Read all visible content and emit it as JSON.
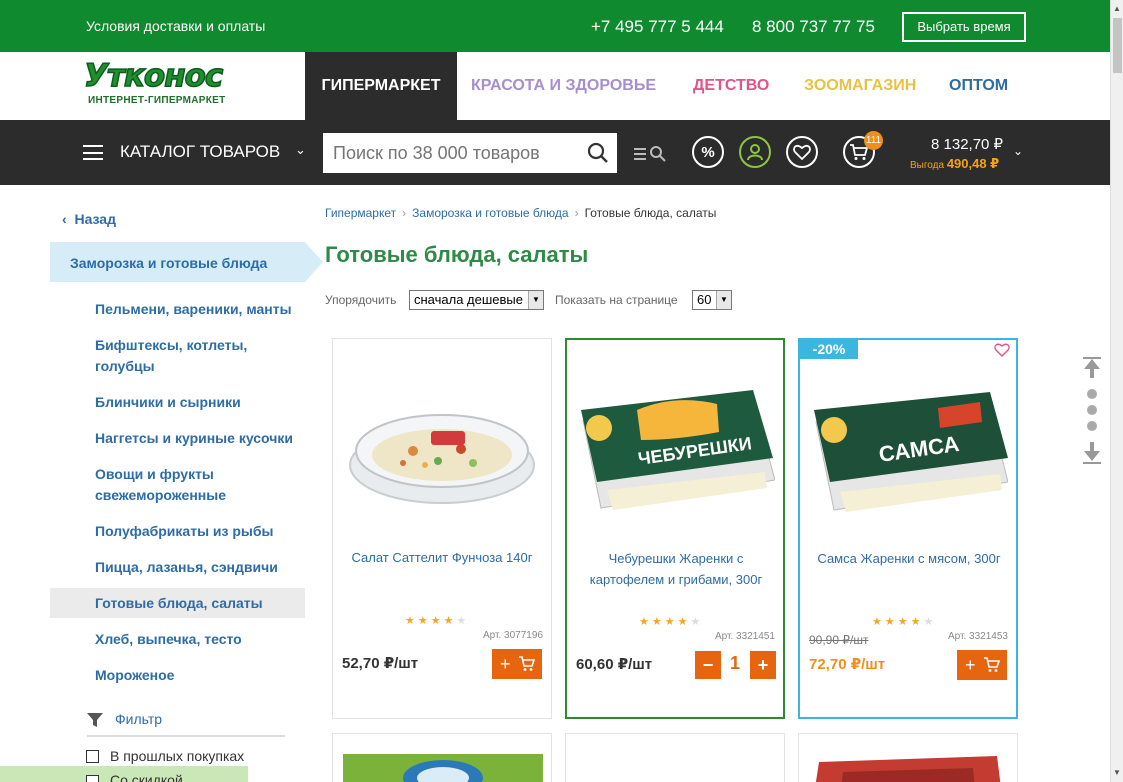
{
  "topbar": {
    "delivery_link": "Условия доставки и оплаты",
    "phone1": "+7 495 777 5 444",
    "phone2": "8 800 737 77 75",
    "time_button": "Выбрать время",
    "bg_color": "#0f8a2e"
  },
  "logo": {
    "word": "Утконос",
    "subtitle": "ИНТЕРНЕТ-ГИПЕРМАРКЕТ"
  },
  "nav": {
    "tabs": [
      {
        "label": "ГИПЕРМАРКЕТ",
        "color": "#ffffff",
        "active": true
      },
      {
        "label": "КРАСОТА И ЗДОРОВЬЕ",
        "color": "#a78ed0"
      },
      {
        "label": "ДЕТСТВО",
        "color": "#e45287"
      },
      {
        "label": "ЗООМАГАЗИН",
        "color": "#e9c244"
      },
      {
        "label": "ОПТОМ",
        "color": "#2d6ca6"
      }
    ]
  },
  "toolbar": {
    "catalog_label": "КАТАЛОГ ТОВАРОВ",
    "search_placeholder": "Поиск по 38 000 товаров",
    "percent_label": "%",
    "cart_count": "111",
    "cart_total": "8 132,70 ₽",
    "benefit_label": "Выгода",
    "benefit_value": "490,48 ₽"
  },
  "sidebar": {
    "back_label": "Назад",
    "section": "Заморозка и готовые блюда",
    "items": [
      {
        "label": "Пельмени, вареники, манты"
      },
      {
        "label": "Бифштексы, котлеты, голубцы"
      },
      {
        "label": "Блинчики и сырники"
      },
      {
        "label": "Наггетсы и куриные кусочки"
      },
      {
        "label": "Овощи и фрукты свежемороженные"
      },
      {
        "label": "Полуфабрикаты из рыбы"
      },
      {
        "label": "Пицца, лазанья, сэндвичи"
      },
      {
        "label": "Готовые блюда, салаты",
        "active": true
      },
      {
        "label": "Хлеб, выпечка, тесто"
      },
      {
        "label": "Мороженое"
      }
    ],
    "filter_label": "Фильтр",
    "checkboxes": [
      {
        "label": "В прошлых покупках"
      },
      {
        "label": "Со скидкой"
      }
    ]
  },
  "breadcrumb": {
    "items": [
      "Гипермаркет",
      "Заморозка и готовые блюда"
    ],
    "current": "Готовые блюда, салаты"
  },
  "page_title": "Готовые блюда, салаты",
  "controls": {
    "sort_label": "Упорядочить",
    "sort_value": "сначала дешевые",
    "per_page_label": "Показать на странице",
    "per_page_value": "60"
  },
  "products": [
    {
      "name": "Салат Саттелит Фунчоза 140г",
      "rating": 4,
      "article": "Арт. 3077196",
      "price": "52,70 ₽/шт",
      "add_label": "+"
    },
    {
      "name": "Чебурешки Жаренки с картофелем и грибами, 300г",
      "rating": 4,
      "article": "Арт. 3321451",
      "price": "60,60 ₽/шт",
      "qty_minus": "−",
      "qty_value": "1",
      "qty_plus": "+",
      "package_text": "ЧЕБУРЕШКИ"
    },
    {
      "name": "Самса Жаренки с мясом, 300г",
      "rating": 4,
      "article": "Арт. 3321453",
      "old_price": "90,90 ₽/шт",
      "price": "72,70 ₽/шт",
      "discount": "-20%",
      "add_label": "+",
      "package_text": "САМСА"
    }
  ],
  "colors": {
    "accent_green": "#2e8a47",
    "link_blue": "#2d6ca6",
    "orange": "#e8650f",
    "cyan": "#3bb7df"
  }
}
